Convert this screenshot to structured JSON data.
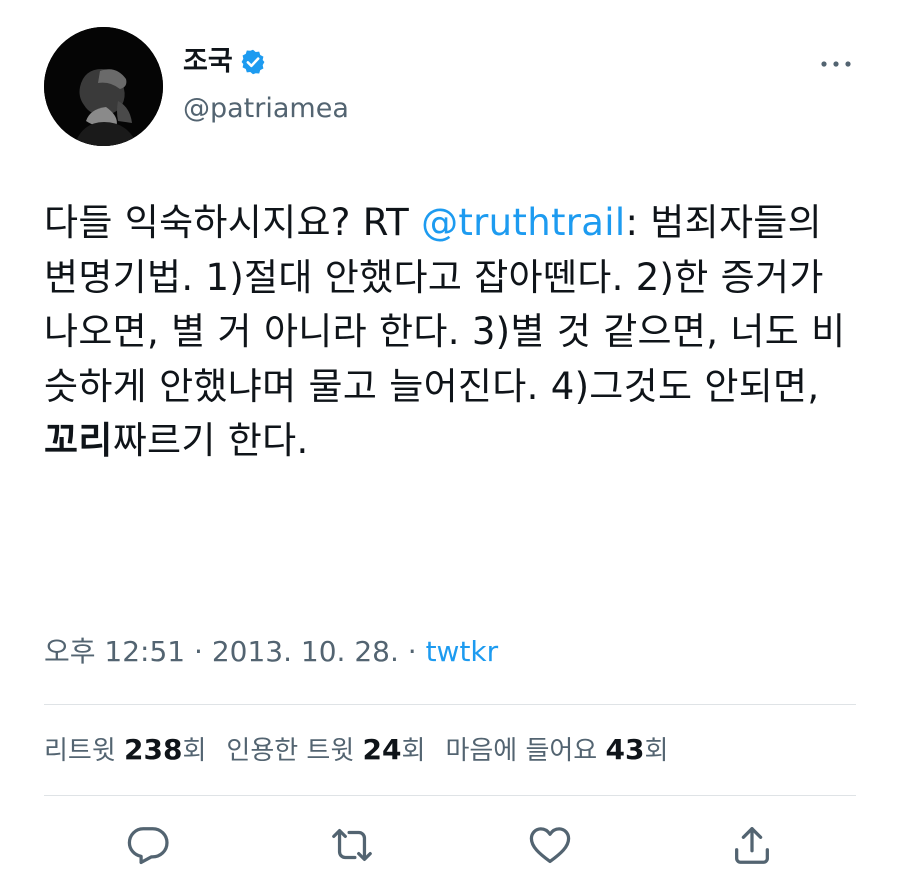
{
  "author": {
    "display_name": "조국",
    "handle": "@patriamea",
    "verified": true,
    "avatar_icon": "user-avatar-photo"
  },
  "tweet": {
    "text_before": "다들 익숙하시지요? RT ",
    "mention": "@truthtrail",
    "text_middle": ": 범죄자들의 변명기법. 1)절대 안했다고 잡아뗀다. 2)한 증거가 나오면, 별 거 아니라 한다. 3)별 것 같으면, 너도 비슷하게 안했냐며 물고 늘어진다. 4)그것도 안되면, ",
    "bold_word": "꼬리",
    "text_after": "짜르기 한다."
  },
  "meta": {
    "time": "오후 12:51",
    "separator": " · ",
    "date": "2013. 10. 28.",
    "separator2": " · ",
    "source": "twtkr"
  },
  "stats": {
    "retweets_label": "리트윗 ",
    "retweets_count": "238",
    "retweets_suffix": "회",
    "quotes_label": "인용한 트윗 ",
    "quotes_count": "24",
    "quotes_suffix": "회",
    "likes_label": "마음에 들어요 ",
    "likes_count": "43",
    "likes_suffix": "회"
  },
  "icons": {
    "more": "more-horizontal-icon",
    "verified": "verified-badge-icon",
    "reply": "reply-icon",
    "retweet": "retweet-icon",
    "like": "heart-icon",
    "share": "share-icon"
  },
  "colors": {
    "accent": "#1d9bf0",
    "text": "#0f1419",
    "secondary": "#536471",
    "divider": "#dfe3e6"
  }
}
